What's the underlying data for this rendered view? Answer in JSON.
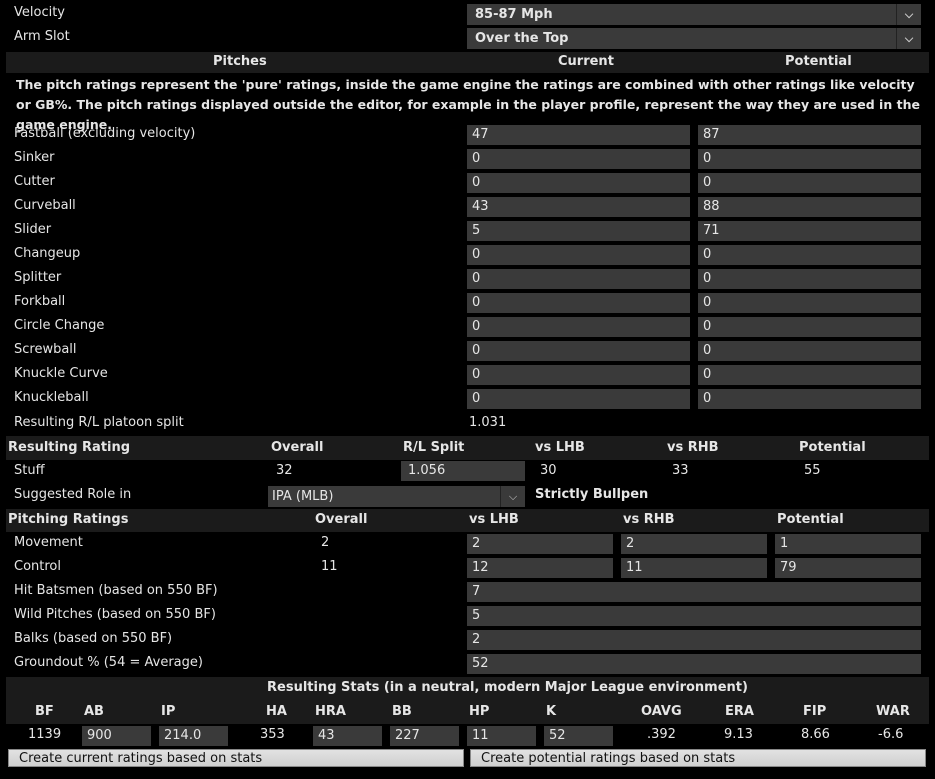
{
  "top": {
    "velocity_label": "Velocity",
    "velocity_value": "85-87 Mph",
    "armslot_label": "Arm Slot",
    "armslot_value": "Over the Top"
  },
  "pitches": {
    "header_pitches": "Pitches",
    "header_current": "Current",
    "header_potential": "Potential",
    "description": "The pitch ratings represent the 'pure' ratings, inside the game engine the ratings are combined with other ratings like velocity or GB%. The pitch ratings displayed outside the editor, for example in the player profile, represent the way they are used in the game engine.",
    "rows": [
      {
        "name": "Fastball (excluding velocity)",
        "current": "47",
        "potential": "87"
      },
      {
        "name": "Sinker",
        "current": "0",
        "potential": "0"
      },
      {
        "name": "Cutter",
        "current": "0",
        "potential": "0"
      },
      {
        "name": "Curveball",
        "current": "43",
        "potential": "88"
      },
      {
        "name": "Slider",
        "current": "5",
        "potential": "71"
      },
      {
        "name": "Changeup",
        "current": "0",
        "potential": "0"
      },
      {
        "name": "Splitter",
        "current": "0",
        "potential": "0"
      },
      {
        "name": "Forkball",
        "current": "0",
        "potential": "0"
      },
      {
        "name": "Circle Change",
        "current": "0",
        "potential": "0"
      },
      {
        "name": "Screwball",
        "current": "0",
        "potential": "0"
      },
      {
        "name": "Knuckle Curve",
        "current": "0",
        "potential": "0"
      },
      {
        "name": "Knuckleball",
        "current": "0",
        "potential": "0"
      }
    ],
    "platoon_label": "Resulting R/L platoon split",
    "platoon_value": "1.031"
  },
  "resulting": {
    "h_title": "Resulting Rating",
    "h_overall": "Overall",
    "h_rl": "R/L Split",
    "h_lhb": "vs LHB",
    "h_rhb": "vs RHB",
    "h_potential": "Potential",
    "stuff_label": "Stuff",
    "stuff_overall": "32",
    "stuff_rl": "1.056",
    "stuff_lhb": "30",
    "stuff_rhb": "33",
    "stuff_potential": "55",
    "role_label": "Suggested Role in",
    "role_value": "IPA (MLB)",
    "role_text": "Strictly Bullpen"
  },
  "pitching": {
    "h_title": "Pitching Ratings",
    "h_overall": "Overall",
    "h_lhb": "vs LHB",
    "h_rhb": "vs RHB",
    "h_potential": "Potential",
    "movement_label": "Movement",
    "movement_overall": "2",
    "movement_lhb": "2",
    "movement_rhb": "2",
    "movement_potential": "1",
    "control_label": "Control",
    "control_overall": "11",
    "control_lhb": "12",
    "control_rhb": "11",
    "control_potential": "79",
    "hbp_label": "Hit Batsmen (based on 550 BF)",
    "hbp_value": "7",
    "wp_label": "Wild Pitches (based on 550 BF)",
    "wp_value": "5",
    "balk_label": "Balks (based on 550 BF)",
    "balk_value": "2",
    "go_label": "Groundout % (54 = Average)",
    "go_value": "52"
  },
  "stats": {
    "title": "Resulting Stats (in a neutral, modern Major League environment)",
    "h_bf": "BF",
    "h_ab": "AB",
    "h_ip": "IP",
    "h_ha": "HA",
    "h_hra": "HRA",
    "h_bb": "BB",
    "h_hp": "HP",
    "h_k": "K",
    "h_oavg": "OAVG",
    "h_era": "ERA",
    "h_fip": "FIP",
    "h_war": "WAR",
    "bf": "1139",
    "ab": "900",
    "ip": "214.0",
    "ha": "353",
    "hra": "43",
    "bb": "227",
    "hp": "11",
    "k": "52",
    "oavg": ".392",
    "era": "9.13",
    "fip": "8.66",
    "war": "-6.6"
  },
  "buttons": {
    "current": "Create current ratings based on stats",
    "potential": "Create potential ratings based on stats"
  }
}
